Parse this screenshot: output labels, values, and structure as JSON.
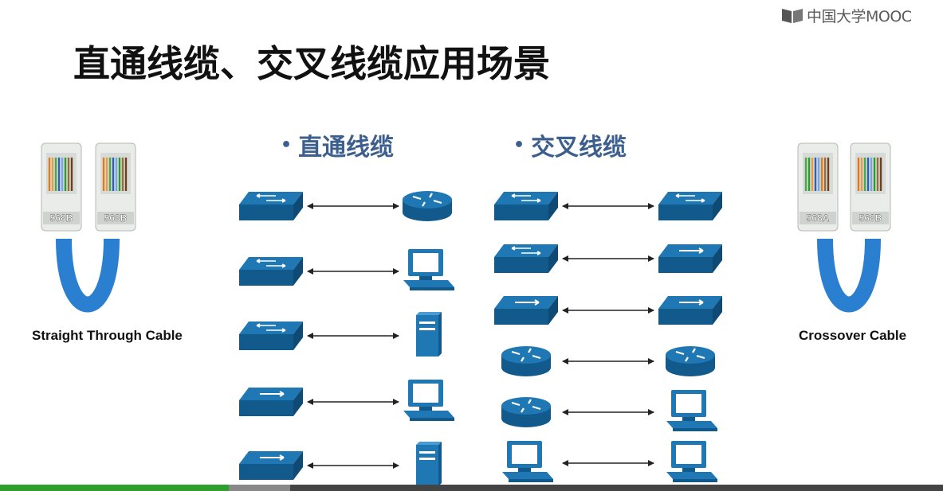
{
  "watermark": {
    "brand_text": "中国大学MOOC"
  },
  "slide": {
    "title": "直通线缆、交叉线缆应用场景",
    "headings": {
      "straight": "直通线缆",
      "crossover": "交叉线缆"
    },
    "cable_left": {
      "caption": "Straight Through Cable",
      "plug_labels": [
        "568B",
        "568B"
      ]
    },
    "cable_right": {
      "caption": "Crossover Cable",
      "plug_labels": [
        "568A",
        "568B"
      ]
    },
    "straight_pairs": [
      [
        "switch",
        "router"
      ],
      [
        "switch",
        "pc"
      ],
      [
        "switch",
        "server"
      ],
      [
        "hub",
        "pc"
      ],
      [
        "hub",
        "server"
      ]
    ],
    "crossover_pairs": [
      [
        "switch",
        "switch"
      ],
      [
        "switch",
        "hub"
      ],
      [
        "hub",
        "hub"
      ],
      [
        "router",
        "router"
      ],
      [
        "router",
        "pc"
      ],
      [
        "pc",
        "pc"
      ]
    ]
  },
  "player": {
    "progress": 0.243,
    "buffered": 0.308
  },
  "colors": {
    "device_blue": "#1f78b4",
    "device_dark": "#135a8c",
    "heading_blue": "#3d5f8e",
    "cable_blue": "#2a7fd0",
    "progress_green": "#2e9e2e"
  }
}
